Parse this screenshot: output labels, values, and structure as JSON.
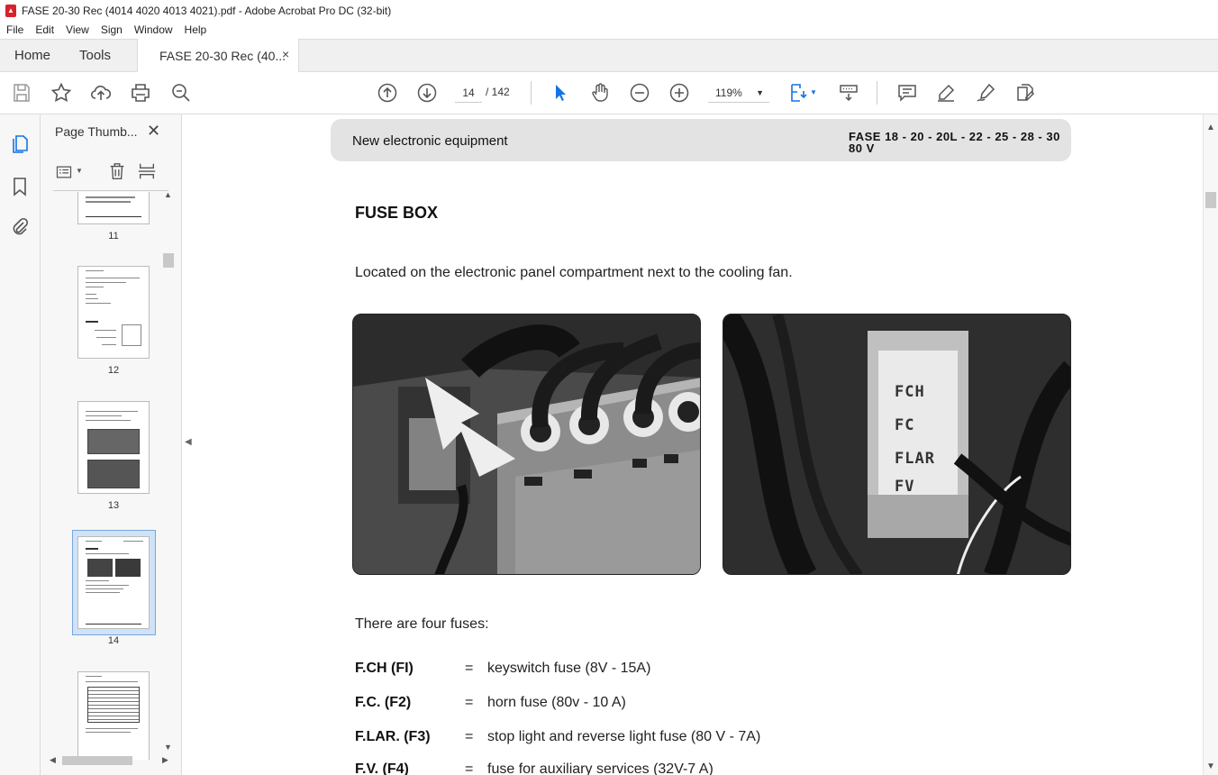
{
  "window": {
    "title": "FASE 20-30 Rec (4014 4020 4013 4021).pdf - Adobe Acrobat Pro DC (32-bit)"
  },
  "menu": [
    "File",
    "Edit",
    "View",
    "Sign",
    "Window",
    "Help"
  ],
  "tabs": {
    "home": "Home",
    "tools": "Tools",
    "doc": "FASE 20-30 Rec (40...",
    "close": "×"
  },
  "toolbar": {
    "page_current": "14",
    "page_of": "/  142",
    "zoom": "119%"
  },
  "thumbnails": {
    "panel_title": "Page Thumb...",
    "close": "✕",
    "pages": [
      {
        "num": "11"
      },
      {
        "num": "12"
      },
      {
        "num": "13"
      },
      {
        "num": "14",
        "selected": true
      },
      {
        "num": ""
      }
    ]
  },
  "document": {
    "header_left": "New electronic equipment",
    "header_right_line1": "FASE 18 - 20 - 20L - 22 - 25 - 28 - 30",
    "header_right_line2": "80 V",
    "heading": "FUSE BOX",
    "intro": "Located on the electronic panel compartment next to the cooling fan.",
    "fuses_intro": "There are four fuses:",
    "photo_labels": [
      "FCH",
      "FC",
      "FLAR",
      "FV"
    ],
    "fuses": [
      {
        "code": "F.CH (FI)",
        "eq": "=",
        "desc": "keyswitch fuse (8V - 15A)"
      },
      {
        "code": "F.C. (F2)",
        "eq": "=",
        "desc": "horn fuse (80v - 10 A)"
      },
      {
        "code": "F.LAR. (F3)",
        "eq": "=",
        "desc": "stop light and reverse light fuse (80 V - 7A)"
      },
      {
        "code": "F.V. (F4)",
        "eq": "=",
        "desc": "fuse for auxiliary services (32V-7 A)"
      }
    ]
  },
  "colors": {
    "accent_blue": "#1473e6",
    "header_band": "#e3e3e3",
    "selected_thumb": "#cfe2f7"
  }
}
